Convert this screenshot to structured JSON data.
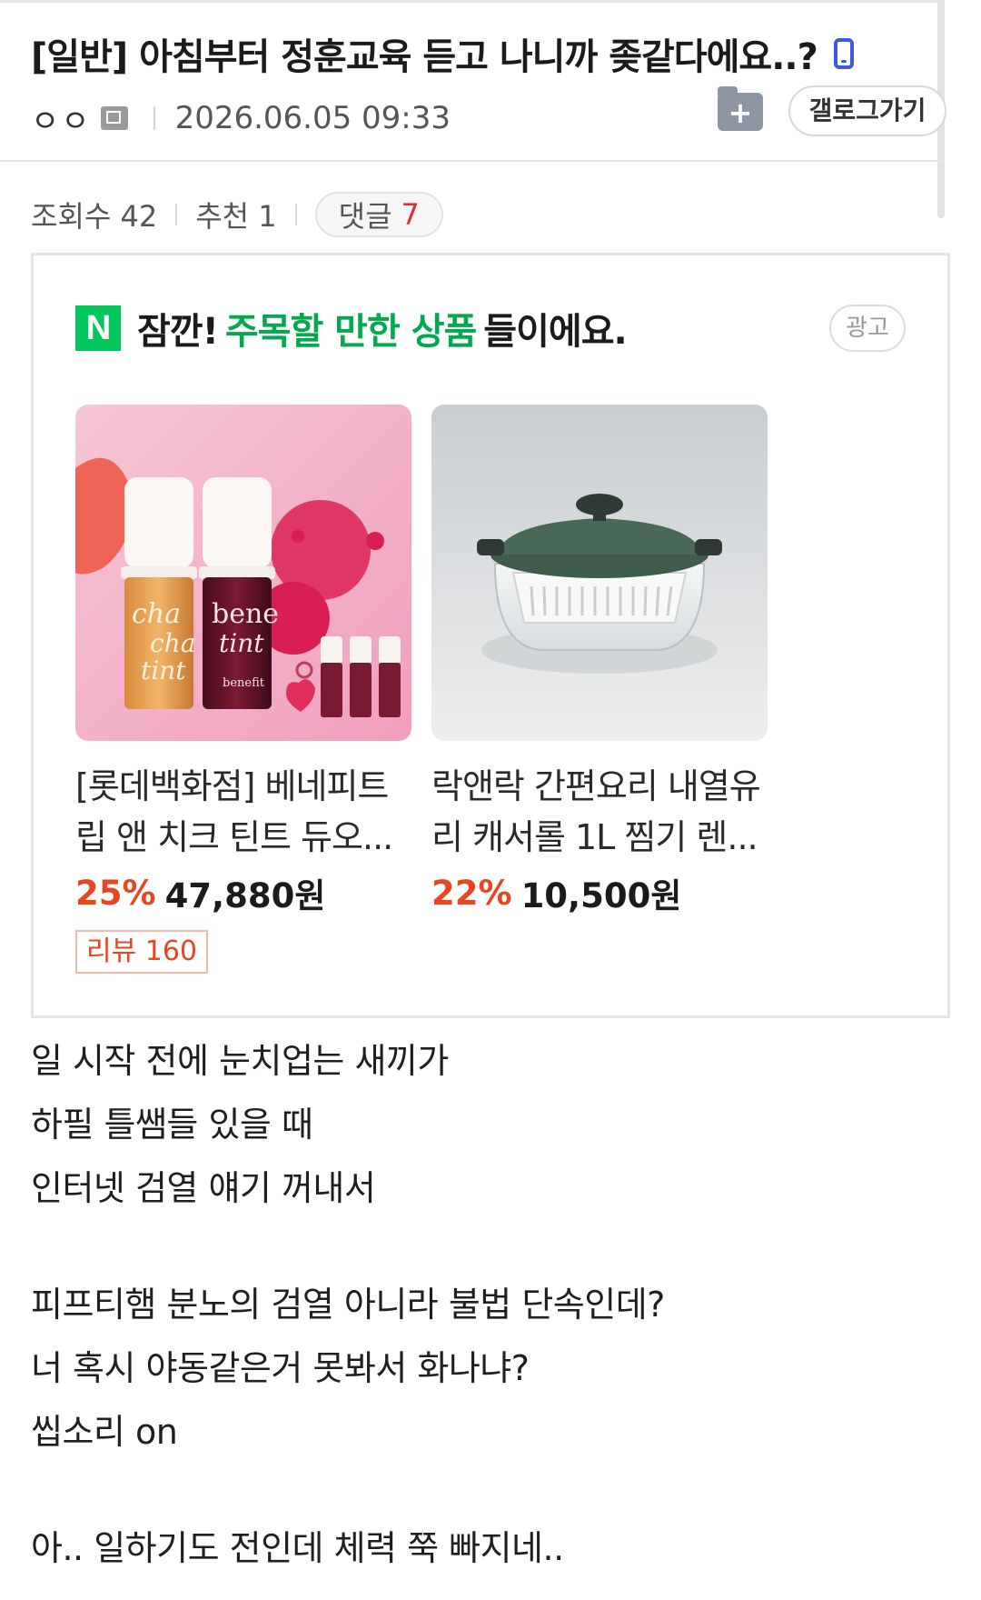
{
  "header": {
    "title": "[일반] 아침부터 정훈교육 듣고 나니까 좆같다에요..?",
    "author": "ㅇㅇ",
    "date": "2026.06.05 09:33",
    "gallery_button": "갤로그가기",
    "add_folder": "+"
  },
  "stats": {
    "views_label": "조회수 42",
    "recommend_label": "추천 1",
    "comments_label": "댓글",
    "comments_count": "7"
  },
  "ad": {
    "logo": "N",
    "heading_prefix": "잠깐!",
    "heading_accent": "주목할 만한 상품",
    "heading_suffix": "들이에요.",
    "tag": "광고",
    "products": [
      {
        "name": "[롯데백화점] 베네피트 립 앤 치크 틴트 듀오...",
        "discount": "25%",
        "price": "47,880원",
        "review": "리뷰 160"
      },
      {
        "name": "락앤락 간편요리 내열유리 캐서롤 1L 찜기 렌...",
        "discount": "22%",
        "price": "10,500원"
      }
    ]
  },
  "body": {
    "lines": [
      "일 시작 전에 눈치업는 새끼가",
      "하필 틀쌤들 있을 때",
      "인터넷 검열 얘기 꺼내서",
      "",
      "피프티햄 분노의 검열 아니라 불법 단속인데?",
      "너 혹시 야동같은거 못봐서 화나냐?",
      "씹소리 on",
      "",
      "아.. 일하기도 전인데 체력 쭉 빠지네.."
    ]
  },
  "colors": {
    "naver_green": "#03c75a",
    "discount_red": "#e8461f",
    "comment_red": "#e03131",
    "phone_blue": "#3b5bdb"
  }
}
